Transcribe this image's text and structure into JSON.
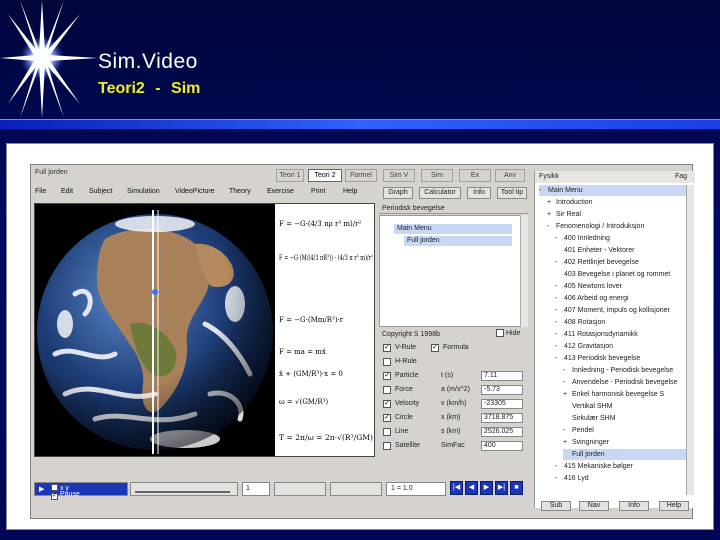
{
  "slide": {
    "title": "Sim.Video",
    "subtitle": "Teori2  -  Sim"
  },
  "app": {
    "window_title": "Full jorden",
    "title_tabs": [
      "Teori 1",
      "Teori 2",
      "Formel",
      "Sim V",
      "Sim",
      "Ex",
      "Anv"
    ],
    "active_tab": "Teori 2",
    "menu": [
      "File",
      "Edit",
      "Subject",
      "Simulation",
      "VideoPicture",
      "Theory",
      "Exercise",
      "Print",
      "Help"
    ],
    "menu_buttons": [
      "Graph",
      "Calculator",
      "Info",
      "Tool tip"
    ],
    "formulas": {
      "f1": "F = −G·(4/3 πρ r³ m)/r²",
      "f2": "F = −G·(M/(4/3 πR³)) · (4/3 π r³ m)/r²",
      "f3": "F = −G·(Mm/R³)·r",
      "f4": "F = ma = mẍ",
      "f5": "ẍ + (GM/R³)·x = 0",
      "f6": "ω = √(GM/R³)",
      "f7": "T = 2π/ω = 2π·√(R³/GM)"
    },
    "panel": {
      "heading": "Periodisk bevegelse",
      "main_menu": "Main Menu",
      "sub_item": "Full jorden",
      "copyright": "Copyright S 1998b",
      "hide_label": "Hide",
      "rows": [
        {
          "label": "V-Rule",
          "checked": true,
          "var": "Formula",
          "var_checked": true,
          "value": ""
        },
        {
          "label": "H-Rule",
          "checked": false,
          "var": "",
          "value": ""
        },
        {
          "label": "Particle",
          "checked": true,
          "var": "t (s)",
          "value": "7.11"
        },
        {
          "label": "Force",
          "checked": false,
          "var": "a (m/s^2)",
          "value": "-5.73"
        },
        {
          "label": "Velocity",
          "checked": true,
          "var": "v (km/h)",
          "value": "-23305"
        },
        {
          "label": "Circle",
          "checked": true,
          "var": "x (km)",
          "value": "3718.875"
        },
        {
          "label": "Line",
          "checked": false,
          "var": "s (km)",
          "value": "2526.025"
        },
        {
          "label": "Satellite",
          "checked": false,
          "var": "SimFac",
          "value": "400"
        }
      ]
    },
    "bottom": {
      "checks": [
        {
          "label": "x y",
          "checked": false
        },
        {
          "label": "Pause",
          "checked": true
        }
      ],
      "frame_value": "1",
      "counter": "1 = 1.0",
      "nav_buttons": [
        "|◀",
        "◀",
        "▶",
        "▶|",
        "■"
      ]
    },
    "tree": {
      "heading": "Fysikk",
      "heading_right": "Fag",
      "items": [
        {
          "prefix": "-",
          "text": "Main Menu",
          "indent": 0,
          "selected": true
        },
        {
          "prefix": "+",
          "text": "Introduction",
          "indent": 1
        },
        {
          "prefix": "+",
          "text": "Sir Real",
          "indent": 1
        },
        {
          "prefix": "-",
          "text": "Fenomenologi / Introduksjon",
          "indent": 1
        },
        {
          "prefix": "-",
          "text": "400 Innledning",
          "indent": 2
        },
        {
          "prefix": "",
          "text": "401 Enheter - Vektorer",
          "indent": 2
        },
        {
          "prefix": "-",
          "text": "402 Rettlinjet bevegelse",
          "indent": 2
        },
        {
          "prefix": "",
          "text": "403 Bevegelse i planet og rommet",
          "indent": 2
        },
        {
          "prefix": "-",
          "text": "405 Newtons lover",
          "indent": 2
        },
        {
          "prefix": "-",
          "text": "406 Arbeid og energi",
          "indent": 2
        },
        {
          "prefix": "-",
          "text": "407 Moment, impuls og kollisjoner",
          "indent": 2
        },
        {
          "prefix": "-",
          "text": "408 Rotasjon",
          "indent": 2
        },
        {
          "prefix": "-",
          "text": "411 Rotasjonsdynamikk",
          "indent": 2
        },
        {
          "prefix": "-",
          "text": "412 Gravitasjon",
          "indent": 2
        },
        {
          "prefix": "-",
          "text": "413 Periodisk bevegelse",
          "indent": 2
        },
        {
          "prefix": "-",
          "text": "Innledning - Periodisk bevegelse",
          "indent": 3
        },
        {
          "prefix": "-",
          "text": "Anvendelse - Periodisk bevegelse",
          "indent": 3
        },
        {
          "prefix": "+",
          "text": "Enkel harmonisk bevegelse S",
          "indent": 3
        },
        {
          "prefix": "",
          "text": "Vertikal SHM",
          "indent": 3
        },
        {
          "prefix": "",
          "text": "Sirkulær SHM",
          "indent": 3
        },
        {
          "prefix": "-",
          "text": "Pendel",
          "indent": 3
        },
        {
          "prefix": "+",
          "text": "Svingninger",
          "indent": 3
        },
        {
          "prefix": "",
          "text": "Full jorden",
          "indent": 3,
          "selected": true
        },
        {
          "prefix": "-",
          "text": "415 Mekaniske bølger",
          "indent": 2
        },
        {
          "prefix": "-",
          "text": "416 Lyd",
          "indent": 2
        }
      ],
      "buttons": [
        "Sub",
        "Nav",
        "Info",
        "Help"
      ]
    }
  },
  "colors": {
    "slide_bg": "#00063a",
    "bar": "#2f62ff",
    "title": "#ffffff",
    "subtitle": "#f2ec28",
    "selection": "#c8d8f4",
    "nav_button": "#1d36b8"
  }
}
